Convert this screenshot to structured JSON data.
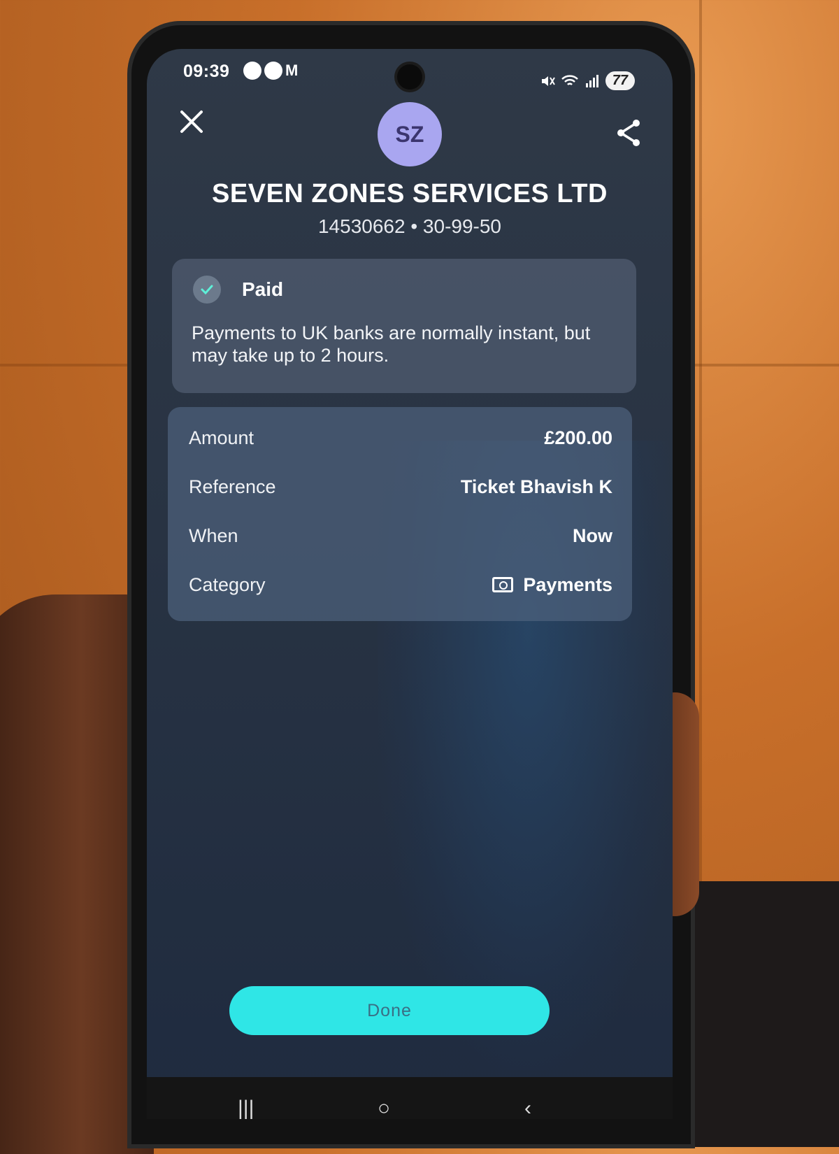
{
  "status_bar": {
    "time": "09:39",
    "notification_icons": [
      "shazam-icon",
      "whatsapp-icon",
      "gmail-icon"
    ],
    "gmail_glyph": "M",
    "battery": "77"
  },
  "header": {
    "avatar_initials": "SZ",
    "payee_name": "SEVEN ZONES SERVICES LTD",
    "account_info": "14530662 • 30-99-50"
  },
  "status_card": {
    "status": "Paid",
    "message": "Payments to UK banks are normally instant, but may take up to 2 hours."
  },
  "details": {
    "rows": [
      {
        "label": "Amount",
        "value": "£200.00"
      },
      {
        "label": "Reference",
        "value": "Ticket Bhavish K"
      },
      {
        "label": "When",
        "value": "Now"
      },
      {
        "label": "Category",
        "value": "Payments",
        "icon": "banknote-icon"
      }
    ]
  },
  "footer": {
    "done_label": "Done"
  },
  "nav": {
    "recents": "|||",
    "home": "○",
    "back": "‹"
  },
  "colors": {
    "accent_button": "#2fe6e6",
    "avatar_bg": "#a9a6f0",
    "screen_bg": "#2f3947"
  }
}
